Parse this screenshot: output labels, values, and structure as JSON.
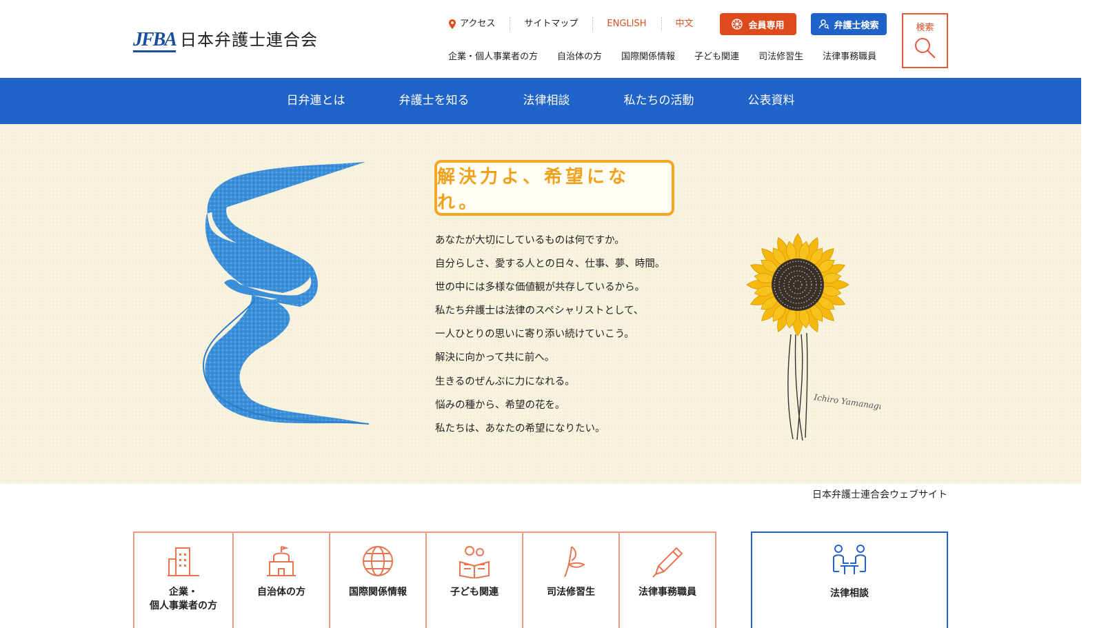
{
  "header": {
    "logo_mark": "JFBA",
    "logo_text": "日本弁護士連合会",
    "util_links": [
      {
        "label": "アクセス"
      },
      {
        "label": "サイトマップ"
      },
      {
        "label": "ENGLISH"
      },
      {
        "label": "中文"
      }
    ],
    "member_button": "会員専用",
    "lawyer_search_button": "弁護士検索",
    "search_label": "検索",
    "sub_nav": [
      "企業・個人事業者の方",
      "自治体の方",
      "国際関係情報",
      "子ども関連",
      "司法修習生",
      "法律事務職員"
    ]
  },
  "main_nav": [
    "日弁連とは",
    "弁護士を知る",
    "法律相談",
    "私たちの活動",
    "公表資料"
  ],
  "hero": {
    "tagline": "解決力よ、希望になれ。",
    "poem": [
      "あなたが大切にしているものは何ですか。",
      "自分らしさ、愛する人との日々、仕事、夢、時間。",
      "世の中には多様な価値観が共存しているから。",
      "私たち弁護士は法律のスペシャリストとして、",
      "一人ひとりの思いに寄り添い続けていこう。",
      "解決に向かって共に前へ。",
      "生きるのぜんぶに力になれる。",
      "悩みの種から、希望の花を。",
      "私たちは、あなたの希望になりたい。"
    ],
    "signature": "Ichiro Yamanaguchi"
  },
  "site_caption": "日本弁護士連合会ウェブサイト",
  "tiles": [
    {
      "label": "企業・\n個人事業者の方",
      "icon": "building-icon"
    },
    {
      "label": "自治体の方",
      "icon": "town-hall-icon"
    },
    {
      "label": "国際関係情報",
      "icon": "globe-icon"
    },
    {
      "label": "子ども関連",
      "icon": "child-reading-icon"
    },
    {
      "label": "司法修習生",
      "icon": "sprout-icon"
    },
    {
      "label": "法律事務職員",
      "icon": "pencil-icon"
    }
  ],
  "consult_tile": {
    "label": "法律相談",
    "icon": "consultation-icon"
  },
  "colors": {
    "brand_blue": "#1f62c8",
    "accent_orange": "#de4a1c",
    "tagline_yellow": "#f0a11b",
    "hero_bg": "#f8f3df"
  }
}
